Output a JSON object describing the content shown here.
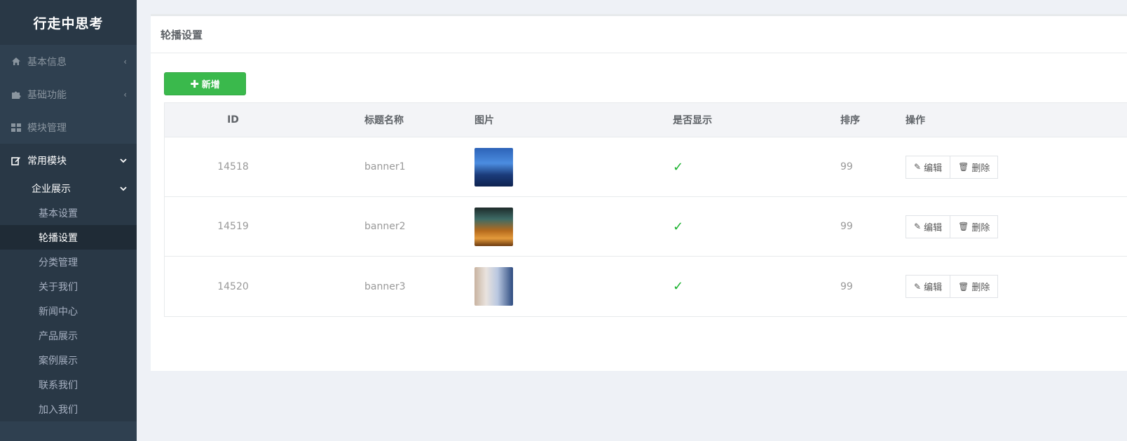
{
  "brand": "行走中思考",
  "nav": [
    {
      "label": "基本信息",
      "icon": "home-icon"
    },
    {
      "label": "基础功能",
      "icon": "puzzle-icon"
    },
    {
      "label": "模块管理",
      "icon": "grid-icon"
    },
    {
      "label": "常用模块",
      "icon": "edit-icon"
    }
  ],
  "submenu": {
    "head": "企业展示",
    "items": [
      "基本设置",
      "轮播设置",
      "分类管理",
      "关于我们",
      "新闻中心",
      "产品展示",
      "案例展示",
      "联系我们",
      "加入我们"
    ]
  },
  "panel": {
    "title": "轮播设置",
    "add_label": "新增"
  },
  "table": {
    "headers": [
      "ID",
      "标题名称",
      "图片",
      "是否显示",
      "排序",
      "操作"
    ],
    "rows": [
      {
        "id": "14518",
        "title": "banner1",
        "sort": "99"
      },
      {
        "id": "14519",
        "title": "banner2",
        "sort": "99"
      },
      {
        "id": "14520",
        "title": "banner3",
        "sort": "99"
      }
    ],
    "edit_label": "编辑",
    "delete_label": "删除"
  },
  "colors": {
    "sidebar": "#2f4050",
    "accent_green": "#3ab94c",
    "check_green": "#1ab22e"
  }
}
